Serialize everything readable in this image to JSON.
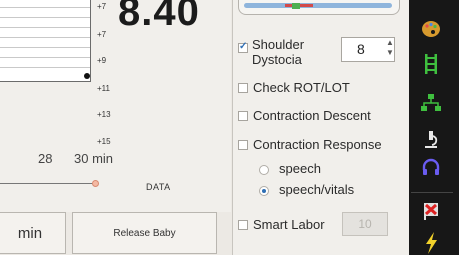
{
  "chart": {
    "big_value": "8.40",
    "scale_labels": [
      "+7",
      "+9",
      "+11",
      "+13",
      "+15"
    ],
    "x_ticks": [
      "28",
      "30 min"
    ],
    "data_label": "DATA"
  },
  "buttons": {
    "min_label": "min",
    "release_baby": "Release Baby"
  },
  "options": {
    "shoulder_dystocia": {
      "label_line1": "Shoulder",
      "label_line2": "Dystocia",
      "checked": true,
      "stepper_value": "8"
    },
    "check_rot_lot": {
      "label": "Check ROT/LOT",
      "checked": false
    },
    "contraction_descent": {
      "label": "Contraction Descent",
      "checked": false
    },
    "contraction_response": {
      "label": "Contraction Response",
      "checked": false
    },
    "response_modes": [
      {
        "label": "speech",
        "selected": false
      },
      {
        "label": "speech/vitals",
        "selected": true
      }
    ],
    "smart_labor": {
      "label": "Smart Labor",
      "checked": false,
      "value": "10"
    }
  },
  "toolbar": {
    "icons": [
      "palette-icon",
      "ladder-icon",
      "network-icon",
      "microscope-icon",
      "headset-icon",
      "flag-icon",
      "lightning-icon"
    ]
  },
  "colors": {
    "accent": "#2f6fb5",
    "toolbar_bg": "#171717"
  }
}
